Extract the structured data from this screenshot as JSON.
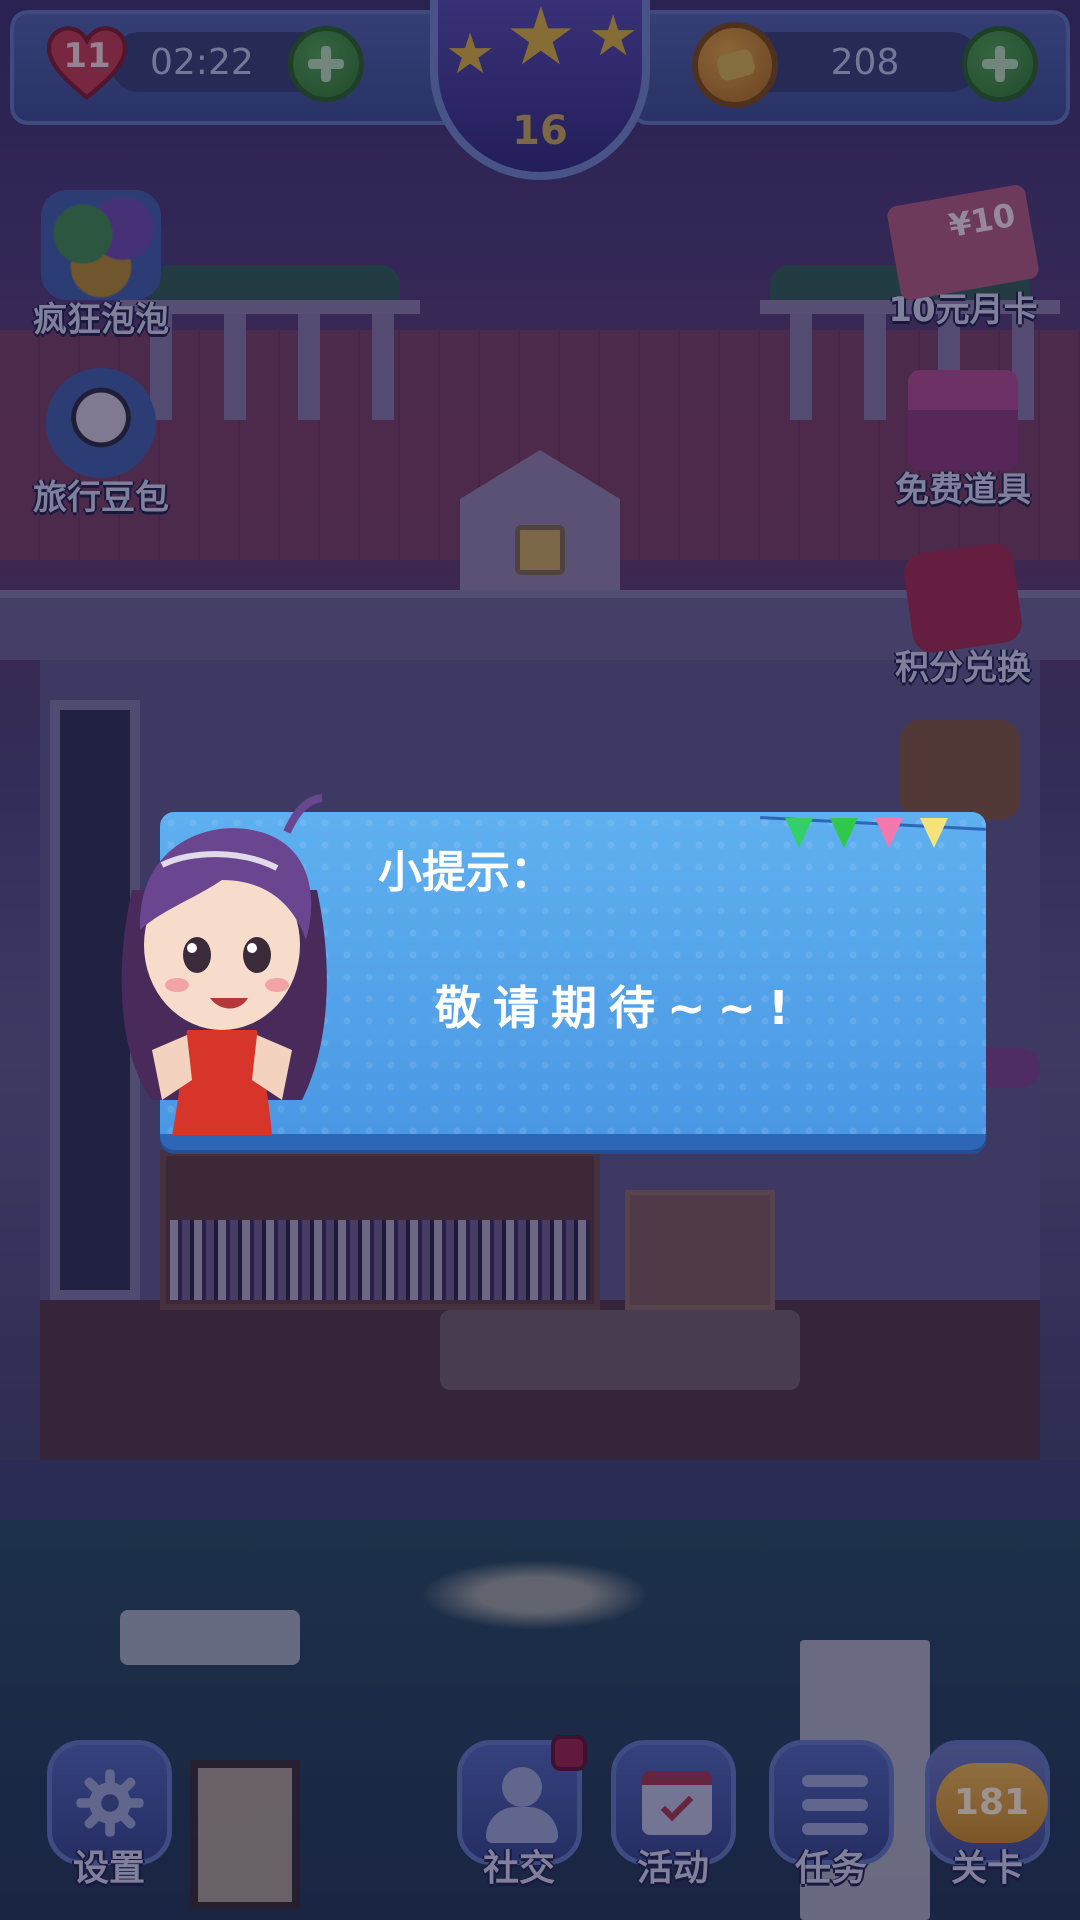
{
  "hud": {
    "lives": "11",
    "timer": "02:22",
    "level": "16",
    "coins": "208"
  },
  "side_menu_left": [
    {
      "label": "疯狂泡泡",
      "icon": "bubbles-icon"
    },
    {
      "label": "旅行豆包",
      "icon": "pug-icon"
    }
  ],
  "side_menu_right": [
    {
      "label": "10元月卡",
      "icon": "monthly-card-icon",
      "icon_text": "¥10"
    },
    {
      "label": "免费道具",
      "icon": "gift-box-icon"
    },
    {
      "label": "积分兑换",
      "icon": "jd-icon"
    }
  ],
  "bottom_nav": [
    {
      "label": "设置",
      "icon": "gear-icon"
    },
    {
      "label": "社交",
      "icon": "friends-icon"
    },
    {
      "label": "活动",
      "icon": "calendar-icon"
    },
    {
      "label": "任务",
      "icon": "task-list-icon"
    },
    {
      "label": "关卡",
      "icon": "level-icon",
      "badge": "181"
    }
  ],
  "dialog": {
    "title": "小提示：",
    "message": "敬请期待~~!"
  },
  "colors": {
    "dialog_bg": "#4a98e4",
    "dialog_border": "#2d66b6",
    "hud_bg": "#3b4e8c",
    "plus_green": "#2f7a2c"
  }
}
